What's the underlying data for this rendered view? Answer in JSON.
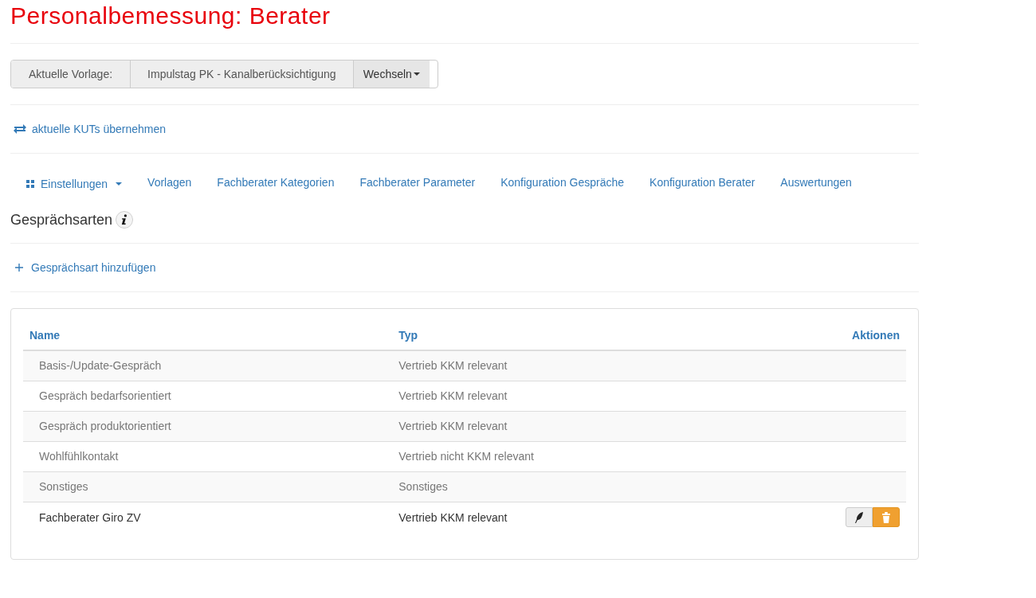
{
  "title": "Personalbemessung: Berater",
  "template_bar": {
    "label": "Aktuelle Vorlage:",
    "value": "Impulstag PK - Kanalberücksichtigung",
    "button": "Wechseln"
  },
  "sync_link": "aktuelle KUTs übernehmen",
  "nav": [
    {
      "label": "Einstellungen",
      "kind": "dropdown"
    },
    {
      "label": "Vorlagen",
      "kind": "link"
    },
    {
      "label": "Fachberater Kategorien",
      "kind": "link"
    },
    {
      "label": "Fachberater Parameter",
      "kind": "link"
    },
    {
      "label": "Konfiguration Gespräche",
      "kind": "link"
    },
    {
      "label": "Konfiguration Berater",
      "kind": "link"
    },
    {
      "label": "Auswertungen",
      "kind": "link"
    }
  ],
  "section_title": "Gesprächsarten",
  "add_link": "Gesprächsart hinzufügen",
  "table": {
    "columns": [
      "Name",
      "Typ",
      "Aktionen"
    ],
    "rows": [
      {
        "name": "Basis-/Update-Gespräch",
        "type": "Vertrieb KKM relevant",
        "muted": true,
        "actions": false
      },
      {
        "name": "Gespräch bedarfsorientiert",
        "type": "Vertrieb KKM relevant",
        "muted": true,
        "actions": false
      },
      {
        "name": "Gespräch produktorientiert",
        "type": "Vertrieb KKM relevant",
        "muted": true,
        "actions": false
      },
      {
        "name": "Wohlfühlkontakt",
        "type": "Vertrieb nicht KKM relevant",
        "muted": true,
        "actions": false
      },
      {
        "name": "Sonstiges",
        "type": "Sonstiges",
        "muted": true,
        "actions": false
      },
      {
        "name": "Fachberater Giro ZV",
        "type": "Vertrieb KKM relevant",
        "muted": false,
        "actions": true
      }
    ]
  }
}
